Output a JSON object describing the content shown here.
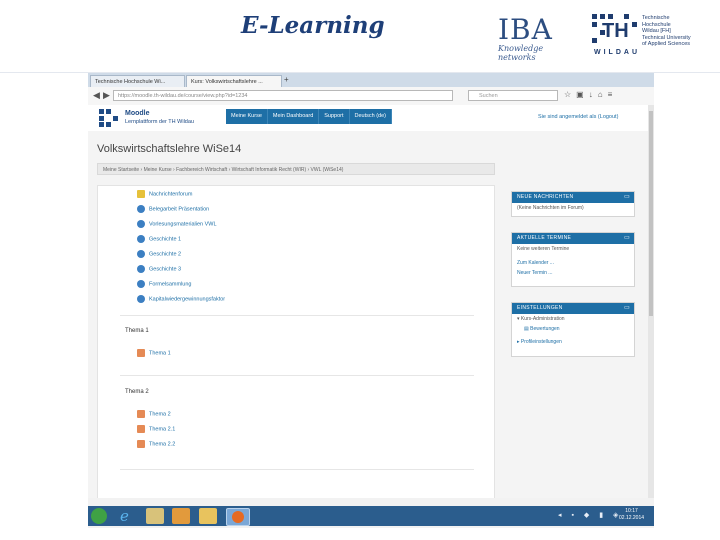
{
  "slide": {
    "title": "E-Learning"
  },
  "logos": {
    "iba": {
      "name": "IBA",
      "tagline": "Knowledge networks"
    },
    "th": {
      "mark": "TH",
      "name": "WILDAU",
      "lines": [
        "Technische",
        "Hochschule",
        "Wildau [FH]",
        "Technical University",
        "of Applied Sciences"
      ]
    }
  },
  "browser": {
    "tabs": [
      {
        "label": "Technische Hochschule Wi..."
      },
      {
        "label": "Kurs: Volkswirtschaftslehre ..."
      }
    ],
    "url": "https://moodle.th-wildau.de/course/view.php?id=1234",
    "search_placeholder": "Suchen",
    "icons": [
      "star-icon",
      "bookmark-icon",
      "download-icon",
      "home-icon",
      "menu-icon"
    ]
  },
  "moodle": {
    "brand_line1": "Moodle",
    "brand_line2": "Lernplattform der TH Wildau",
    "menu": [
      "Meine Kurse",
      "Mein Dashboard",
      "Support",
      "Deutsch (de)"
    ],
    "user_link": "Sie sind angemeldet als (Logout)",
    "course_title": "Volkswirtschaftslehre WiSe14",
    "breadcrumb": "Meine Startseite  ›  Meine Kurse  ›  Fachbereich Wirtschaft  ›  Wirtschaft Informatik Recht (WIR)  ›  VWL (WiSe14)",
    "items": [
      {
        "label": "Nachrichtenforum",
        "icon": "forum-icon"
      },
      {
        "label": "Belegarbeit Präsentation",
        "icon": "link-icon"
      },
      {
        "label": "Vorlesungsmaterialien VWL",
        "icon": "link-icon"
      },
      {
        "label": "Geschichte 1",
        "icon": "link-icon"
      },
      {
        "label": "Geschichte 2",
        "icon": "link-icon"
      },
      {
        "label": "Geschichte 3",
        "icon": "link-icon"
      },
      {
        "label": "Formelsammlung",
        "icon": "link-icon"
      },
      {
        "label": "Kapitalwiedergewinnungsfaktor",
        "icon": "link-icon"
      }
    ],
    "sections": [
      {
        "title": "Thema 1",
        "items": [
          "Thema 1"
        ]
      },
      {
        "title": "Thema 2",
        "items": [
          "Thema 2",
          "Thema 2.1",
          "Thema 2.2"
        ]
      }
    ],
    "blocks": {
      "news": {
        "title": "NEUE NACHRICHTEN",
        "lines": [
          "(Keine Nachrichten im Forum)"
        ]
      },
      "events": {
        "title": "AKTUELLE TERMINE",
        "lines": [
          "Keine weiteren Termine",
          "Zum Kalender ...",
          "Neuer Termin ..."
        ]
      },
      "settings": {
        "title": "EINSTELLUNGEN",
        "lines": [
          "Kurs-Administration",
          "Bewertungen",
          "Profileinstellungen"
        ]
      }
    }
  },
  "taskbar": {
    "apps": [
      "internet-explorer-icon",
      "explorer-icon",
      "media-player-icon",
      "folder-icon",
      "firefox-icon"
    ],
    "clock_time": "10:17",
    "clock_date": "02.12.2014"
  }
}
